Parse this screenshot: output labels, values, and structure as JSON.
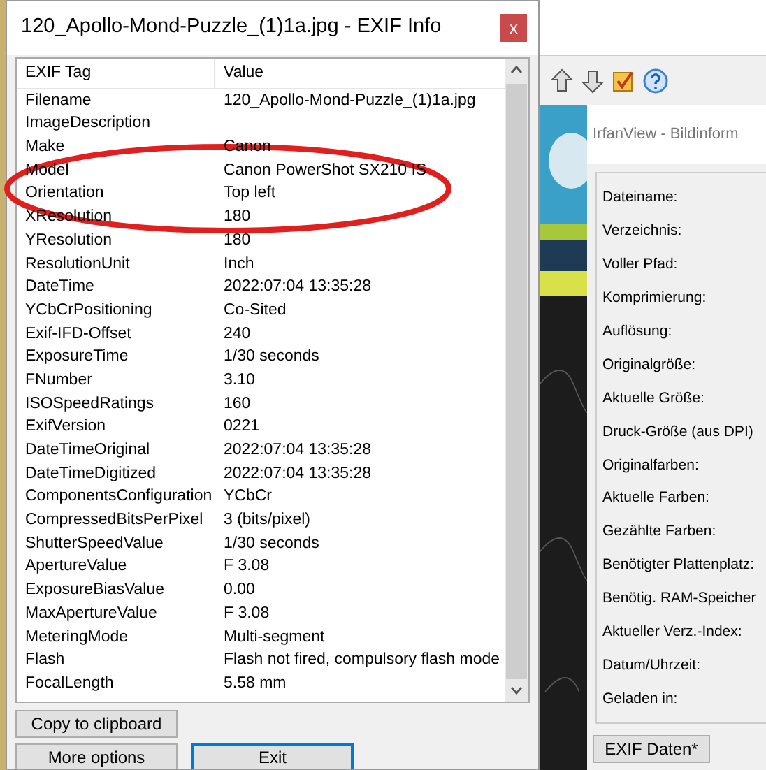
{
  "exif_dialog": {
    "title": "120_Apollo-Mond-Puzzle_(1)1a.jpg - EXIF Info",
    "close_label": "x",
    "columns": [
      "EXIF Tag",
      "Value"
    ],
    "rows": [
      {
        "tag": "Filename",
        "value": "120_Apollo-Mond-Puzzle_(1)1a.jpg"
      },
      {
        "tag": "ImageDescription"
      },
      {
        "tag": "Make",
        "value": "Canon"
      },
      {
        "tag": "Model",
        "value": "Canon PowerShot SX210 IS"
      },
      {
        "tag": "Orientation",
        "value": "Top left"
      },
      {
        "tag": "XResolution",
        "value": "180"
      },
      {
        "tag": "YResolution",
        "value": "180"
      },
      {
        "tag": "ResolutionUnit",
        "value": "Inch"
      },
      {
        "tag": "DateTime",
        "value": "2022:07:04 13:35:28"
      },
      {
        "tag": "YCbCrPositioning",
        "value": "Co-Sited"
      },
      {
        "tag": "Exif-IFD-Offset",
        "value": "240"
      },
      {
        "tag": "ExposureTime",
        "value": "1/30 seconds"
      },
      {
        "tag": "FNumber",
        "value": "3.10"
      },
      {
        "tag": "ISOSpeedRatings",
        "value": "160"
      },
      {
        "tag": "ExifVersion",
        "value": "0221"
      },
      {
        "tag": "DateTimeOriginal",
        "value": "2022:07:04 13:35:28"
      },
      {
        "tag": "DateTimeDigitized",
        "value": "2022:07:04 13:35:28"
      },
      {
        "tag": "ComponentsConfiguration",
        "value": "YCbCr"
      },
      {
        "tag": "CompressedBitsPerPixel",
        "value": "3 (bits/pixel)"
      },
      {
        "tag": "ShutterSpeedValue",
        "value": "1/30 seconds"
      },
      {
        "tag": "ApertureValue",
        "value": "F 3.08"
      },
      {
        "tag": "ExposureBiasValue",
        "value": "0.00"
      },
      {
        "tag": "MaxApertureValue",
        "value": "F 3.08"
      },
      {
        "tag": "MeteringMode",
        "value": "Multi-segment"
      },
      {
        "tag": "Flash",
        "value": "Flash not fired, compulsory flash mode"
      },
      {
        "tag": "FocalLength",
        "value": "5.58 mm"
      }
    ],
    "buttons": [
      {
        "label": "Copy to clipboard",
        "focused": false
      },
      {
        "label": "More options",
        "focused": false
      },
      {
        "label": "Exit",
        "focused": true
      }
    ]
  },
  "info_dialog": {
    "title": "IrfanView - Bildinform",
    "labels": [
      "Dateiname:",
      "Verzeichnis:",
      "Voller Pfad:",
      "Komprimierung:",
      "Auflösung:",
      "Originalgröße:",
      "Aktuelle Größe:",
      "Druck-Größe (aus DPI)",
      "Originalfarben:",
      "Aktuelle Farben:",
      "Gezählte Farben:",
      "Benötigter Plattenplatz:",
      "Benötig. RAM-Speicher",
      "Aktueller Verz.-Index:",
      "Datum/Uhrzeit:",
      "Geladen in:"
    ],
    "buttons": [
      "EXIF Daten*"
    ]
  }
}
